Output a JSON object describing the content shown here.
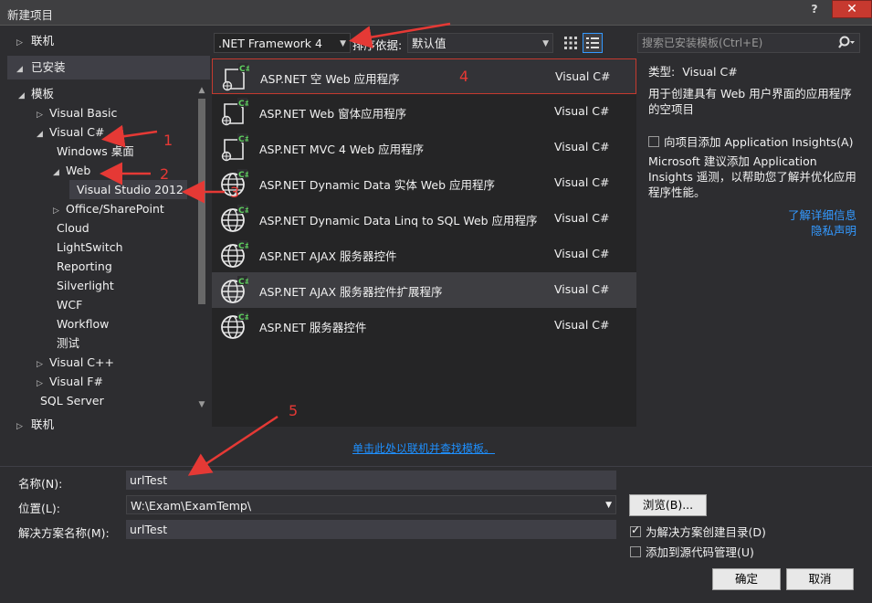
{
  "window": {
    "title": "新建项目",
    "help": "?",
    "close": "✕"
  },
  "left": {
    "online_top": "联机",
    "installed": "已安装",
    "online_bottom": "联机",
    "tree": [
      {
        "label": "模板",
        "level": 0,
        "tri": "◢"
      },
      {
        "label": "Visual Basic",
        "level": 1,
        "tri": "▷"
      },
      {
        "label": "Visual C#",
        "level": 1,
        "tri": "◢"
      },
      {
        "label": "Windows 桌面",
        "level": 2,
        "tri": ""
      },
      {
        "label": "Web",
        "level": 2,
        "tri": "◢"
      },
      {
        "label": "Visual Studio 2012",
        "level": 3,
        "tri": ""
      },
      {
        "label": "Office/SharePoint",
        "level": 2,
        "tri": "▷"
      },
      {
        "label": "Cloud",
        "level": 2,
        "tri": ""
      },
      {
        "label": "LightSwitch",
        "level": 2,
        "tri": ""
      },
      {
        "label": "Reporting",
        "level": 2,
        "tri": ""
      },
      {
        "label": "Silverlight",
        "level": 2,
        "tri": ""
      },
      {
        "label": "WCF",
        "level": 2,
        "tri": ""
      },
      {
        "label": "Workflow",
        "level": 2,
        "tri": ""
      },
      {
        "label": "测试",
        "level": 2,
        "tri": ""
      },
      {
        "label": "Visual C++",
        "level": 1,
        "tri": "▷"
      },
      {
        "label": "Visual F#",
        "level": 1,
        "tri": "▷"
      },
      {
        "label": "SQL Server",
        "level": 1,
        "tri": ""
      }
    ]
  },
  "toolbar": {
    "framework": ".NET Framework 4",
    "sort_label": "排序依据:",
    "sort_value": "默认值"
  },
  "templates": [
    {
      "name": "ASP.NET 空 Web 应用程序",
      "lang": "Visual C#",
      "icon": "doc"
    },
    {
      "name": "ASP.NET Web 窗体应用程序",
      "lang": "Visual C#",
      "icon": "doc"
    },
    {
      "name": "ASP.NET MVC 4 Web 应用程序",
      "lang": "Visual C#",
      "icon": "doc"
    },
    {
      "name": "ASP.NET Dynamic Data 实体 Web 应用程序",
      "lang": "Visual C#",
      "icon": "globe"
    },
    {
      "name": "ASP.NET Dynamic Data Linq to SQL Web 应用程序",
      "lang": "Visual C#",
      "icon": "globe"
    },
    {
      "name": "ASP.NET AJAX 服务器控件",
      "lang": "Visual C#",
      "icon": "globe"
    },
    {
      "name": "ASP.NET AJAX 服务器控件扩展程序",
      "lang": "Visual C#",
      "icon": "globe"
    },
    {
      "name": "ASP.NET 服务器控件",
      "lang": "Visual C#",
      "icon": "globe"
    }
  ],
  "online_link": "单击此处以联机并查找模板。",
  "search": {
    "placeholder": "搜索已安装模板(Ctrl+E)"
  },
  "info": {
    "type_label": "类型:",
    "type_value": "Visual C#",
    "description": "用于创建具有 Web 用户界面的应用程序的空项目",
    "insights_label": "向项目添加 Application Insights(A)",
    "insights_desc": "Microsoft 建议添加 Application Insights 遥测，以帮助您了解并优化应用程序性能。",
    "learn_more": "了解详细信息",
    "privacy": "隐私声明"
  },
  "form": {
    "name_label": "名称(N):",
    "name_value": "urlTest",
    "location_label": "位置(L):",
    "location_value": "W:\\Exam\\ExamTemp\\",
    "solution_label": "解决方案名称(M):",
    "solution_value": "urlTest",
    "browse": "浏览(B)...",
    "create_dir": "为解决方案创建目录(D)",
    "add_source": "添加到源代码管理(U)",
    "ok": "确定",
    "cancel": "取消"
  },
  "annotations": [
    "1",
    "2",
    "3",
    "4",
    "5"
  ],
  "colors": {
    "accent": "#3399ff",
    "annotation": "#e53935",
    "background": "#2d2d30"
  }
}
